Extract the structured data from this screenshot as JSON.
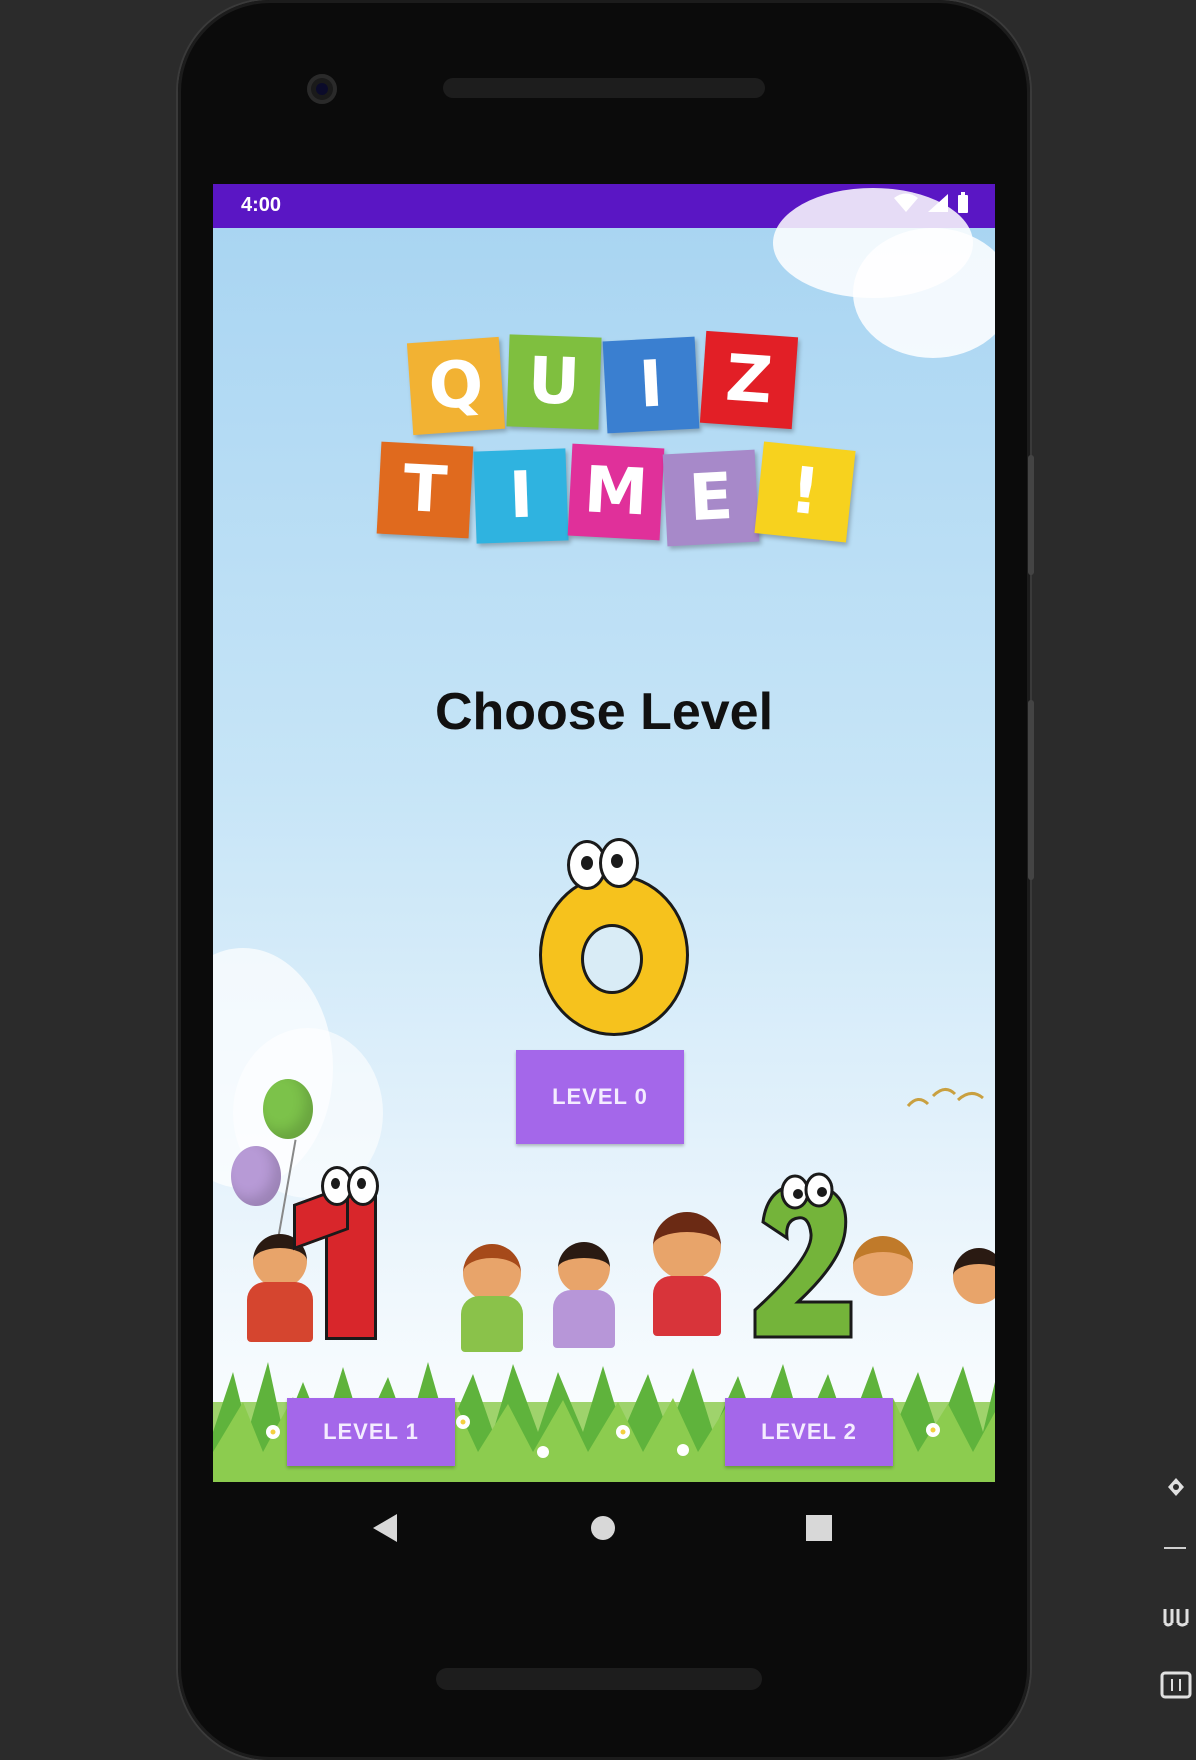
{
  "status_bar": {
    "time": "4:00",
    "icons": [
      "wifi-icon",
      "signal-icon",
      "battery-icon"
    ]
  },
  "logo": {
    "line1": [
      "Q",
      "U",
      "I",
      "Z"
    ],
    "line2": [
      "T",
      "I",
      "M",
      "E",
      "!"
    ],
    "colors_line1": [
      "#f2b233",
      "#7fbf3f",
      "#3a7fd0",
      "#e21f26"
    ],
    "colors_line2": [
      "#e06a1e",
      "#2fb3e0",
      "#e0309a",
      "#a789c9",
      "#f7d21e"
    ]
  },
  "main": {
    "heading": "Choose Level",
    "level_0_label": "LEVEL 0",
    "level_1_label": "LEVEL 1",
    "level_2_label": "LEVEL 2",
    "char_0": "0",
    "char_1": "1",
    "char_2": "2"
  },
  "nav_bar": {
    "icons": [
      "back-icon",
      "home-icon",
      "recents-icon"
    ]
  },
  "colors": {
    "status_bar": "#5a16c4",
    "button": "#a467ea"
  }
}
